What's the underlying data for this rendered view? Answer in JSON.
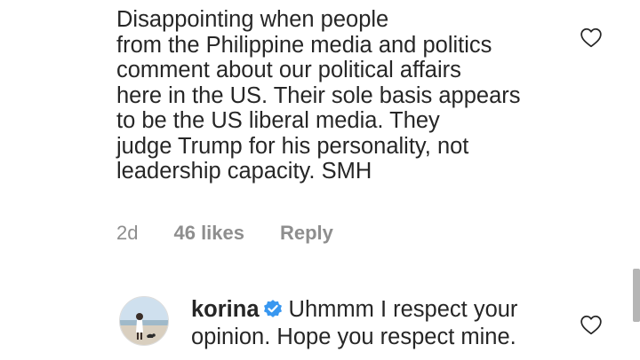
{
  "comment": {
    "text": "Disappointing when people\nfrom the Philippine media and politics\ncomment about our political affairs\nhere in the US. Their sole basis appears\nto be the US liberal media. They\njudge Trump for his personality, not\nleadership capacity. SMH",
    "time": "2d",
    "likes": "46 likes",
    "reply_label": "Reply",
    "like_icon": "heart-outline-icon"
  },
  "reply": {
    "username": "korina",
    "verified_icon": "verified-badge-icon",
    "text": "Uhmmm I respect your opinion. Hope you respect mine.",
    "like_icon": "heart-outline-icon"
  },
  "colors": {
    "text": "#262626",
    "muted": "#8e8e8e",
    "verified": "#3897f0"
  }
}
